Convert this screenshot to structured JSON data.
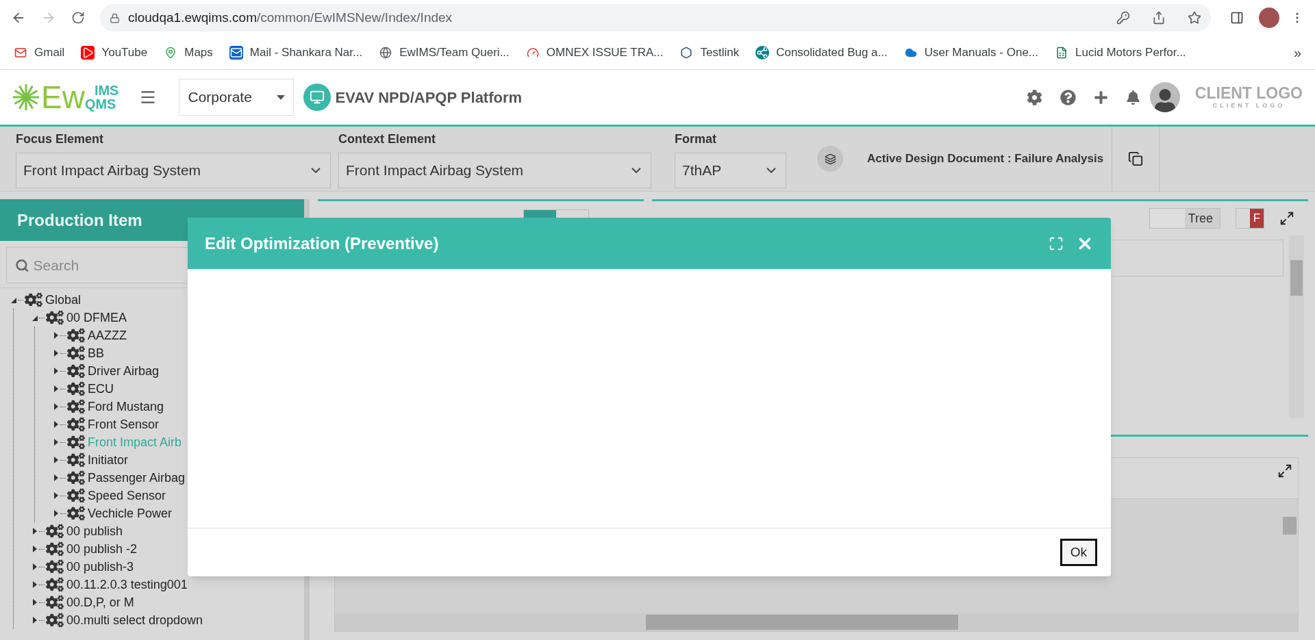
{
  "browser": {
    "url_host": "cloudqa1.ewqims.com",
    "url_path": "/common/EwIMSNew/Index/Index",
    "forward_disabled": true
  },
  "bookmarks": [
    {
      "label": "Gmail",
      "kind": "mail"
    },
    {
      "label": "YouTube",
      "kind": "video"
    },
    {
      "label": "Maps",
      "kind": "map"
    },
    {
      "label": "Mail - Shankara Nar...",
      "kind": "outlook"
    },
    {
      "label": "EwIMS/Team Queri...",
      "kind": "globe"
    },
    {
      "label": "OMNEX ISSUE TRA...",
      "kind": "gauge"
    },
    {
      "label": "Testlink",
      "kind": "hexagon"
    },
    {
      "label": "Consolidated Bug a...",
      "kind": "share"
    },
    {
      "label": "User Manuals - One...",
      "kind": "cloud"
    },
    {
      "label": "Lucid Motors Perfor...",
      "kind": "sheet"
    }
  ],
  "more_bookmarks": "»",
  "header": {
    "logo": {
      "main": "Ew",
      "top": "IMS",
      "bottom": "QMS"
    },
    "org_select": "Corporate",
    "platform": "EVAV NPD/APQP Platform",
    "client_logo": "CLIENT LOGO",
    "client_logo_sub": "CLIENT LOGO"
  },
  "selectors": [
    {
      "label": "Focus Element",
      "value": "Front Impact Airbag System"
    },
    {
      "label": "Context Element",
      "value": "Front Impact Airbag System"
    },
    {
      "label": "Format",
      "value": "7thAP"
    }
  ],
  "active_document": "Active Design Document : Failure Analysis",
  "production_panel": {
    "title": "Production Item",
    "search_placeholder": "Search",
    "tree": [
      {
        "label": "Global",
        "expanded": true,
        "selected": false,
        "children": [
          {
            "label": "00 DFMEA",
            "expanded": true,
            "selected": false,
            "children": [
              {
                "label": "AAZZZ",
                "expanded": false,
                "selected": false
              },
              {
                "label": "BB",
                "expanded": false,
                "selected": false
              },
              {
                "label": "Driver Airbag",
                "expanded": false,
                "selected": false
              },
              {
                "label": "ECU",
                "expanded": false,
                "selected": false
              },
              {
                "label": "Ford Mustang",
                "expanded": false,
                "selected": false
              },
              {
                "label": "Front Sensor",
                "expanded": false,
                "selected": false
              },
              {
                "label": "Front Impact Airb",
                "expanded": false,
                "selected": true
              },
              {
                "label": "Initiator",
                "expanded": false,
                "selected": false
              },
              {
                "label": "Passenger Airbag",
                "expanded": false,
                "selected": false
              },
              {
                "label": "Speed Sensor",
                "expanded": false,
                "selected": false
              },
              {
                "label": "Vechicle Power",
                "expanded": false,
                "selected": false
              }
            ]
          },
          {
            "label": "00 publish",
            "expanded": false,
            "selected": false
          },
          {
            "label": "00 publish -2",
            "expanded": false,
            "selected": false
          },
          {
            "label": "00 publish-3",
            "expanded": false,
            "selected": false
          },
          {
            "label": "00.11.2.0.3 testing001",
            "expanded": false,
            "selected": false
          },
          {
            "label": "00.D,P, or M",
            "expanded": false,
            "selected": false
          },
          {
            "label": "00.multi select dropdown",
            "expanded": false,
            "selected": false
          }
        ]
      }
    ]
  },
  "bom_panel": {
    "switch_on": true
  },
  "structure_panel": {
    "view_toggle": "Tree",
    "flag_toggle": "F"
  },
  "modal": {
    "title": "Edit Optimization (Preventive)",
    "ok": "Ok"
  }
}
